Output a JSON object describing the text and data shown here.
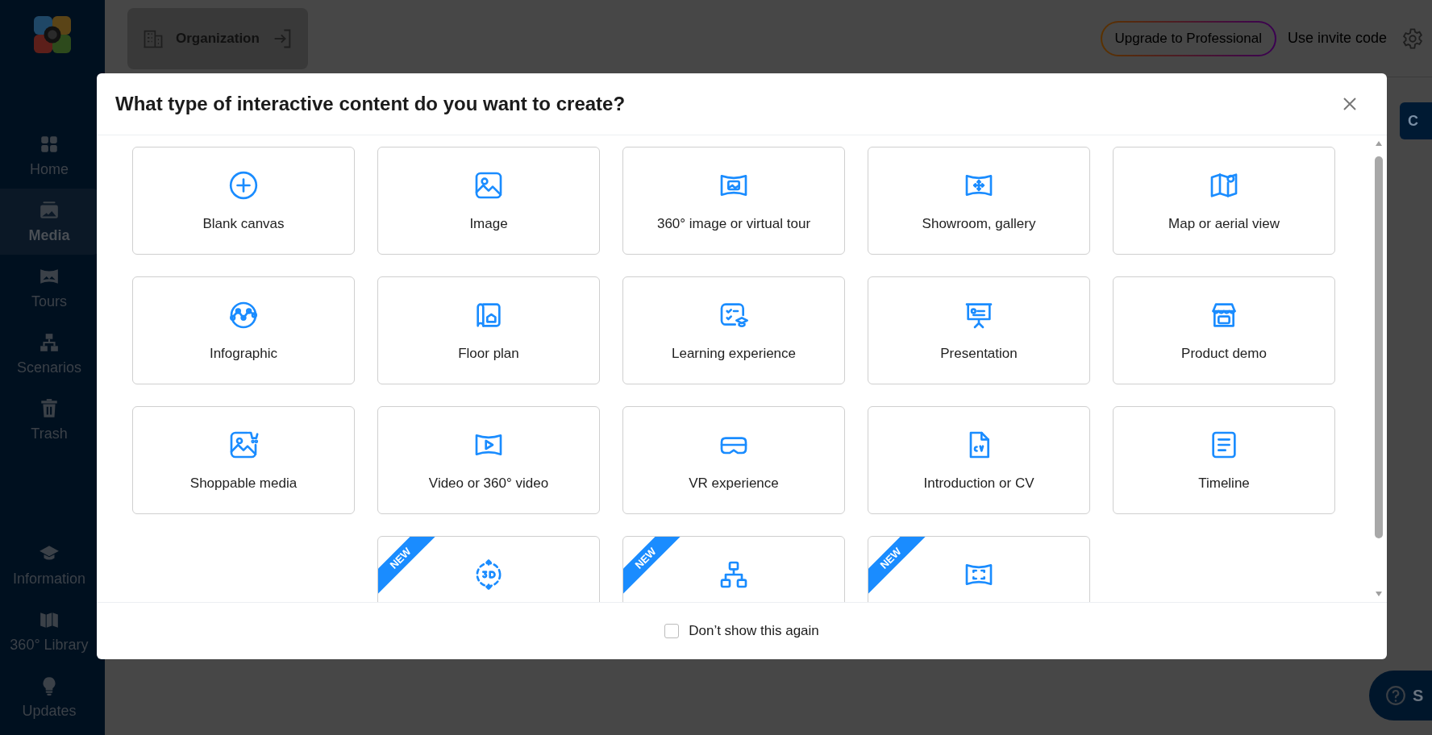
{
  "sidebar": {
    "items": [
      {
        "label": "Home",
        "selected": false
      },
      {
        "label": "Media",
        "selected": true
      },
      {
        "label": "Tours",
        "selected": false
      },
      {
        "label": "Scenarios",
        "selected": false
      },
      {
        "label": "Trash",
        "selected": false
      }
    ],
    "bottom_items": [
      {
        "label": "Information",
        "selected": false
      },
      {
        "label": "360° Library",
        "selected": false
      },
      {
        "label": "Updates",
        "selected": false
      }
    ]
  },
  "topbar": {
    "organization": "Organization",
    "upgrade": "Upgrade to Professional",
    "invite": "Use invite code"
  },
  "page": {
    "create_button": "C",
    "support_button": "S"
  },
  "dialog": {
    "title": "What type of interactive content do you want to create?",
    "options": [
      {
        "label": "Blank canvas"
      },
      {
        "label": "Image"
      },
      {
        "label": "360° image or virtual tour"
      },
      {
        "label": "Showroom, gallery"
      },
      {
        "label": "Map or aerial view"
      },
      {
        "label": "Infographic"
      },
      {
        "label": "Floor plan"
      },
      {
        "label": "Learning experience"
      },
      {
        "label": "Presentation"
      },
      {
        "label": "Product demo"
      },
      {
        "label": "Shoppable media"
      },
      {
        "label": "Video or 360° video"
      },
      {
        "label": "VR experience"
      },
      {
        "label": "Introduction or CV"
      },
      {
        "label": "Timeline"
      },
      {
        "badge": "NEW"
      },
      {
        "badge": "NEW"
      },
      {
        "badge": "NEW"
      }
    ],
    "checkbox": {
      "label": "Don’t show this again",
      "checked": false
    }
  }
}
